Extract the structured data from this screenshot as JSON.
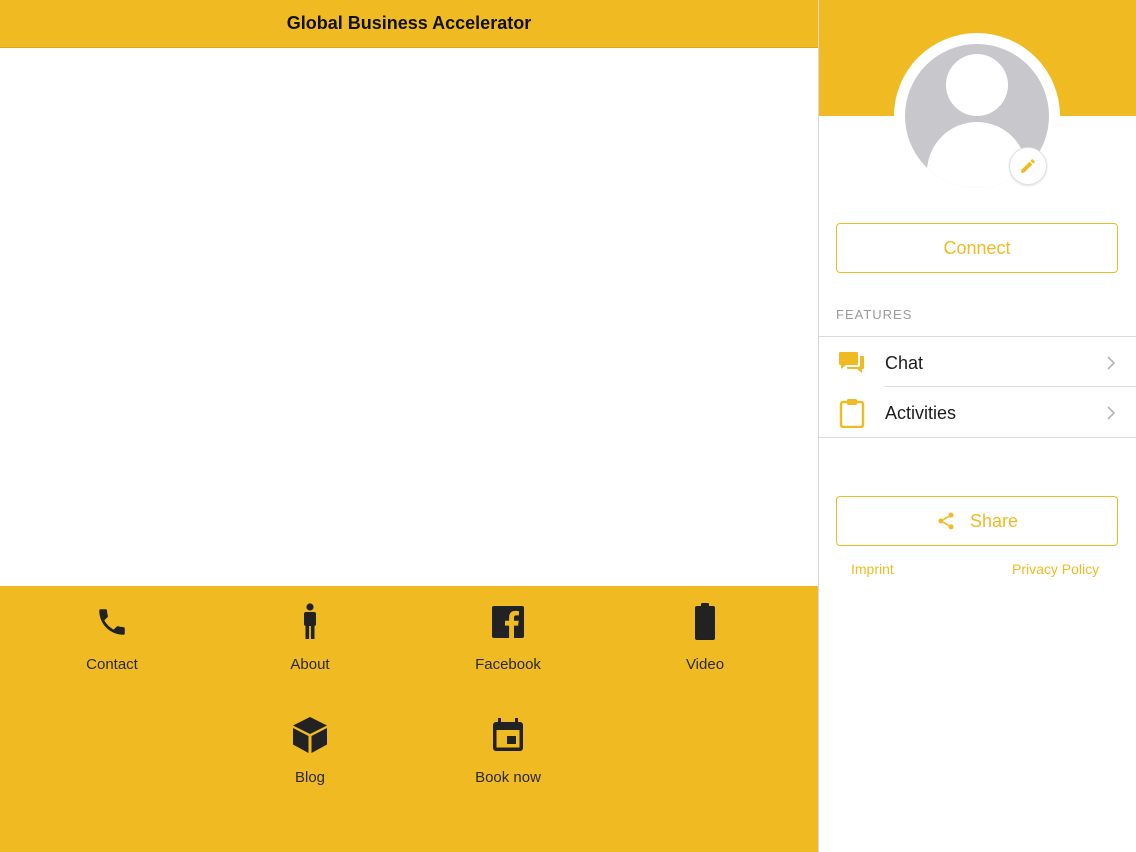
{
  "app": {
    "title": "Global Business Accelerator"
  },
  "colors": {
    "accent": "#f0bb22",
    "text_dark": "#222222",
    "avatar_gray": "#c8c8cc"
  },
  "tiles": [
    {
      "label": "Contact",
      "icon": "phone-icon"
    },
    {
      "label": "About",
      "icon": "person-icon"
    },
    {
      "label": "Facebook",
      "icon": "facebook-icon"
    },
    {
      "label": "Video",
      "icon": "battery-icon"
    },
    {
      "label": "Blog",
      "icon": "cube-icon"
    },
    {
      "label": "Book now",
      "icon": "calendar-icon"
    }
  ],
  "sidebar": {
    "connect_label": "Connect",
    "features_label": "FEATURES",
    "features": [
      {
        "label": "Chat",
        "icon": "chat-icon"
      },
      {
        "label": "Activities",
        "icon": "clipboard-icon"
      }
    ],
    "share_label": "Share",
    "imprint_label": "Imprint",
    "privacy_label": "Privacy Policy"
  }
}
